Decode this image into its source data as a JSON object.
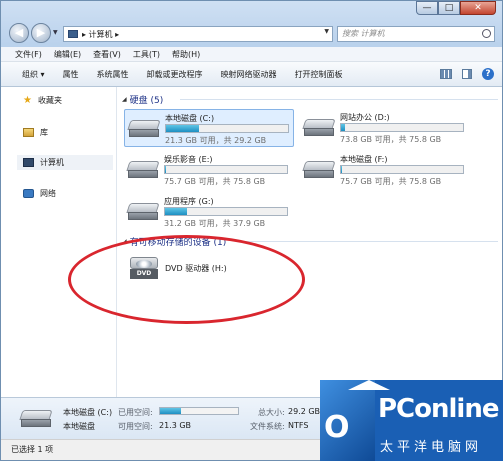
{
  "window": {
    "buttons": {
      "minimize": "—",
      "maximize": "□",
      "close": "✕"
    }
  },
  "address": {
    "path": "▸ 计算机 ▸",
    "search_placeholder": "搜索 计算机"
  },
  "menu": [
    "文件(F)",
    "编辑(E)",
    "查看(V)",
    "工具(T)",
    "帮助(H)"
  ],
  "commands": [
    "组织 ▾",
    "属性",
    "系统属性",
    "卸载或更改程序",
    "映射网络驱动器",
    "打开控制面板"
  ],
  "nav": {
    "favorites": "收藏夹",
    "libraries": "库",
    "computer": "计算机",
    "network": "网络"
  },
  "groups": {
    "hard_disks": "硬盘 (5)",
    "removable": "有可移动存储的设备 (1)"
  },
  "drives": [
    {
      "name": "本地磁盘 (C:)",
      "space": "21.3 GB 可用，共 29.2 GB",
      "used_fraction": 0.27
    },
    {
      "name": "网站办公 (D:)",
      "space": "73.8 GB 可用，共 75.8 GB",
      "used_fraction": 0.03
    },
    {
      "name": "娱乐影音 (E:)",
      "space": "75.7 GB 可用，共 75.8 GB",
      "used_fraction": 0.01
    },
    {
      "name": "本地磁盘 (F:)",
      "space": "75.7 GB 可用，共 75.8 GB",
      "used_fraction": 0.01
    },
    {
      "name": "应用程序 (G:)",
      "space": "31.2 GB 可用，共 37.9 GB",
      "used_fraction": 0.18
    }
  ],
  "dvd": {
    "name": "DVD 驱动器 (H:)",
    "label": "DVD"
  },
  "details": {
    "name": "本地磁盘 (C:)",
    "type": "本地磁盘",
    "used_label": "已用空间:",
    "free_label": "可用空间:",
    "free_value": "21.3 GB",
    "total_label": "总大小:",
    "total_value": "29.2 GB",
    "fs_label": "文件系统:",
    "fs_value": "NTFS",
    "used_fraction": 0.27
  },
  "status": "已选择 1 项",
  "watermark": {
    "o": "O",
    "brand": "PConline",
    "sub": "太平洋电脑网"
  },
  "colors": {
    "accent": "#1e3287",
    "bar": "#1d8fc2",
    "annotation": "#d9262e"
  }
}
